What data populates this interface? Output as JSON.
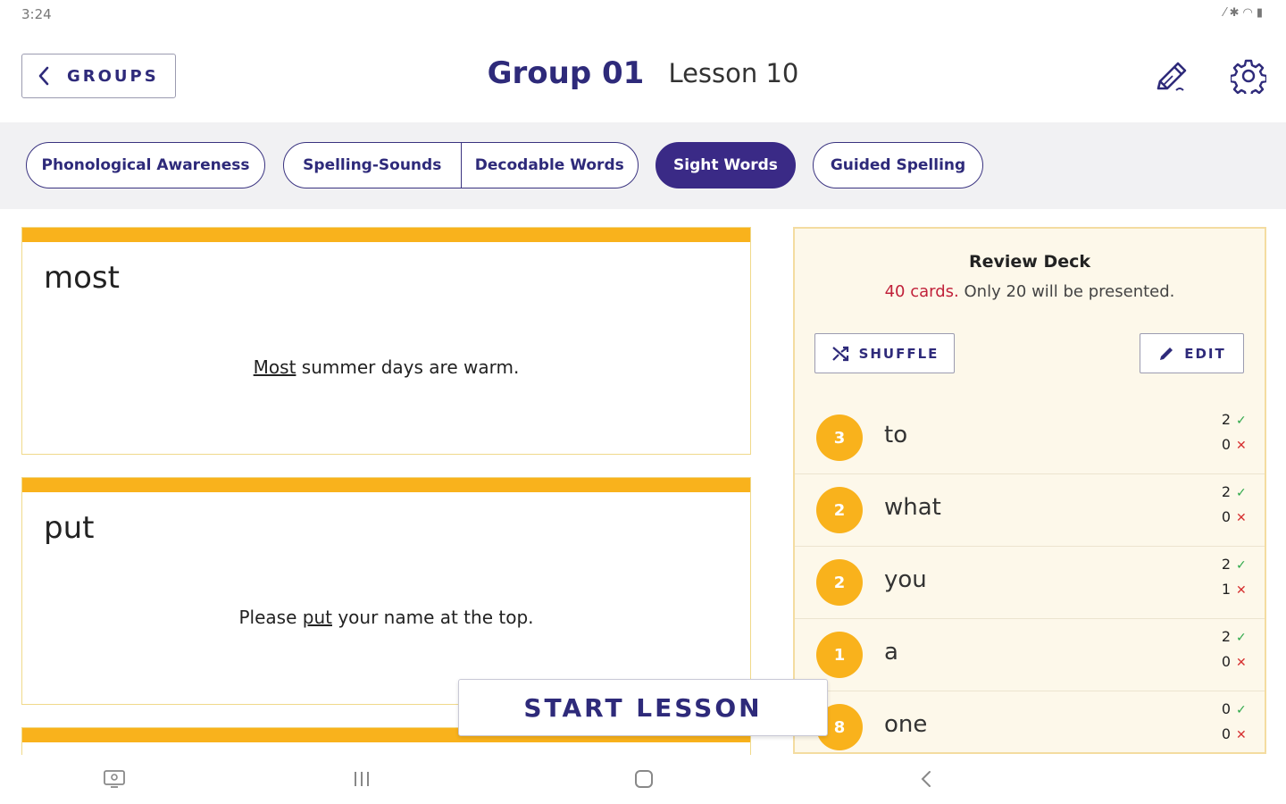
{
  "status_bar": {
    "time": "3:24"
  },
  "header": {
    "back_label": "GROUPS",
    "group_title": "Group 01",
    "lesson_title": "Lesson 10"
  },
  "tabs": {
    "phonological": "Phonological Awareness",
    "spelling_sounds": "Spelling-Sounds",
    "decodable_words": "Decodable Words",
    "sight_words": "Sight Words",
    "guided_spelling": "Guided Spelling",
    "active": "Sight Words"
  },
  "cards": [
    {
      "word": "most",
      "sentence_before": "",
      "sentence_word": "Most",
      "sentence_after": " summer days are warm."
    },
    {
      "word": "put",
      "sentence_before": "Please ",
      "sentence_word": "put",
      "sentence_after": " your name at the top."
    }
  ],
  "start_lesson_label": "START LESSON",
  "review_deck": {
    "title": "Review Deck",
    "count_text": "40 cards.",
    "note_text": " Only 20 will be presented.",
    "shuffle_label": "SHUFFLE",
    "edit_label": "EDIT",
    "items": [
      {
        "level": "3",
        "word": "to",
        "correct": "2",
        "incorrect": "0"
      },
      {
        "level": "2",
        "word": "what",
        "correct": "2",
        "incorrect": "0"
      },
      {
        "level": "2",
        "word": "you",
        "correct": "2",
        "incorrect": "1"
      },
      {
        "level": "1",
        "word": "a",
        "correct": "2",
        "incorrect": "0"
      },
      {
        "level": "8",
        "word": "one",
        "correct": "0",
        "incorrect": "0"
      }
    ]
  },
  "colors": {
    "brand_navy": "#2e2a7a",
    "active_pill": "#3a2a86",
    "accent_yellow": "#f9b21c",
    "panel_bg": "#fdf8ea",
    "count_red": "#c0213a",
    "check_green": "#2ea84a",
    "cross_red": "#d63030"
  },
  "icons": [
    "chevron-left-icon",
    "pencil-icon",
    "gear-icon",
    "shuffle-icon",
    "edit-pencil-icon",
    "check-icon",
    "cross-icon",
    "screenshot-icon",
    "recents-icon",
    "home-icon",
    "back-nav-icon"
  ]
}
